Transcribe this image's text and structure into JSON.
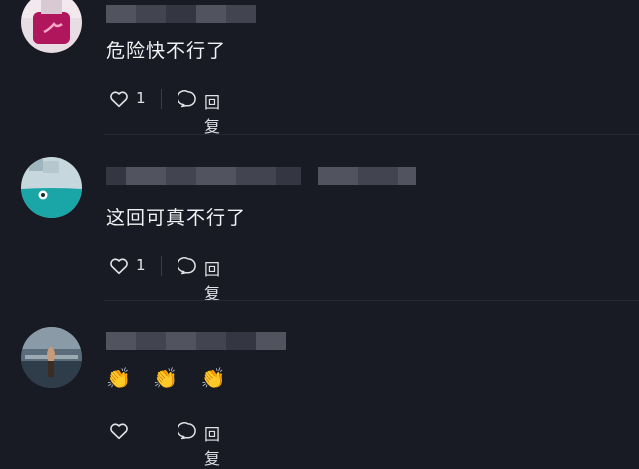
{
  "comments": [
    {
      "text": "危险快不行了",
      "like_count": "1",
      "reply_label": "回复",
      "avatar_icon": "pink-avatar-icon"
    },
    {
      "text": "这回可真不行了",
      "like_count": "1",
      "reply_label": "回复",
      "avatar_icon": "teal-eye-avatar-icon"
    },
    {
      "text": "👏 👏 👏",
      "like_count": "",
      "reply_label": "回复",
      "avatar_icon": "beach-photo-avatar-icon"
    }
  ],
  "colors": {
    "background": "#181a24",
    "text": "#f1f2f5",
    "muted": "#dfe1e6",
    "username_redaction": "#4a4c58"
  }
}
